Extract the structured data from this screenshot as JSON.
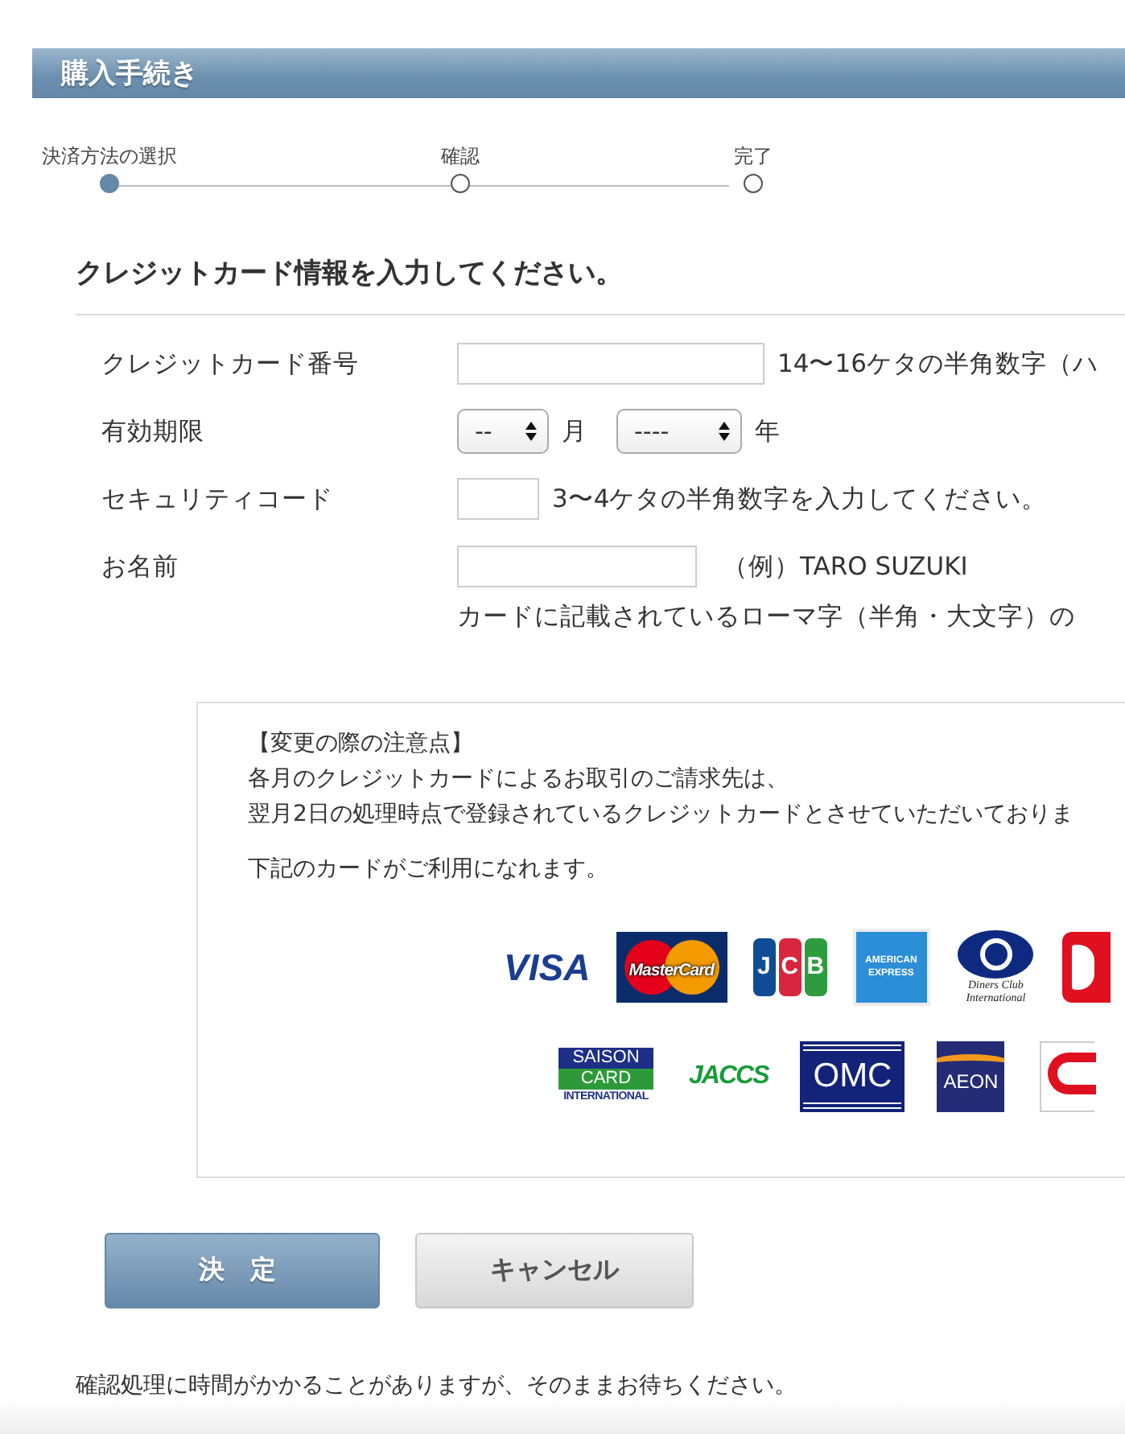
{
  "header": {
    "title": "購入手続き"
  },
  "steps": [
    {
      "label": "決済方法の選択",
      "selected": true
    },
    {
      "label": "確認",
      "selected": false
    },
    {
      "label": "完了",
      "selected": false
    }
  ],
  "section_title": "クレジットカード情報を入力してください。",
  "form": [
    {
      "kind": "text",
      "label": "クレジットカード番号",
      "hint": "14〜16ケタの半角数字（ハ"
    },
    {
      "kind": "expiry",
      "label": "有効期限",
      "selects": [
        {
          "value": "--",
          "unit": "月"
        },
        {
          "value": "----",
          "unit": "年"
        }
      ]
    },
    {
      "kind": "text",
      "label": "セキュリティコード",
      "hint": "3〜4ケタの半角数字を入力してください。"
    },
    {
      "kind": "text",
      "label": "お名前",
      "hint": "（例）TARO SUZUKI",
      "note": "カードに記載されているローマ字（半角・大文字）の"
    }
  ],
  "notice": {
    "heading": "【変更の際の注意点】",
    "lines": [
      "各月のクレジットカードによるお取引のご請求先は、",
      "翌月2日の処理時点で登録されているクレジットカードとさせていただいておりま"
    ],
    "cards_caption": "下記のカードがご利用になれます。"
  },
  "card_rows": [
    [
      {
        "kind": "visa",
        "lines": [
          "VISA"
        ]
      },
      {
        "kind": "mastercard",
        "lines": [
          "MasterCard"
        ]
      },
      {
        "kind": "jcb",
        "lines": [
          "J",
          "C",
          "B"
        ]
      },
      {
        "kind": "amex",
        "lines": [
          "AMERICAN",
          "EXPRESS"
        ]
      },
      {
        "kind": "diners",
        "lines": [
          "Diners Club",
          "International"
        ]
      },
      {
        "kind": "red-partial"
      }
    ],
    [
      {
        "kind": "saison",
        "lines": [
          "SAISON",
          "CARD",
          "INTERNATIONAL"
        ]
      },
      {
        "kind": "jaccs",
        "lines": [
          "JACCS"
        ]
      },
      {
        "kind": "omc",
        "lines": [
          "OMC"
        ]
      },
      {
        "kind": "aeon",
        "lines": [
          "AEON"
        ]
      },
      {
        "kind": "cf-partial"
      }
    ]
  ],
  "buttons": [
    {
      "kind": "primary",
      "label": "決定"
    },
    {
      "kind": "secondary",
      "label": "キャンセル"
    }
  ],
  "footer_note": "確認処理に時間がかかることがありますが、そのままお待ちください。"
}
